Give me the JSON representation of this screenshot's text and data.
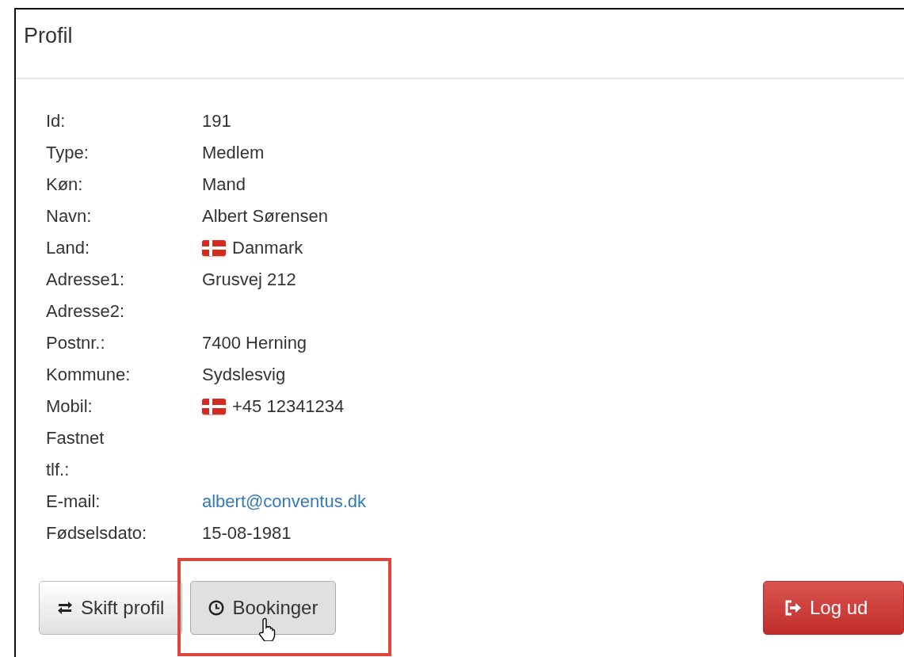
{
  "panel": {
    "title": "Profil"
  },
  "fields": [
    {
      "label": "Id:",
      "value": "191",
      "kind": "text"
    },
    {
      "label": "Type:",
      "value": "Medlem",
      "kind": "text"
    },
    {
      "label": "Køn:",
      "value": "Mand",
      "kind": "text"
    },
    {
      "label": "Navn:",
      "value": "Albert Sørensen",
      "kind": "text"
    },
    {
      "label": "Land:",
      "value": "Danmark",
      "kind": "flag"
    },
    {
      "label": "Adresse1:",
      "value": "Grusvej 212",
      "kind": "text"
    },
    {
      "label": "Adresse2:",
      "kind": "text"
    },
    {
      "label": "Postnr.:",
      "value": "7400 Herning",
      "kind": "text"
    },
    {
      "label": "Kommune:",
      "value": "Sydslesvig",
      "kind": "text"
    },
    {
      "label": "Mobil:",
      "value": "+45 12341234",
      "kind": "flag"
    },
    {
      "label": "Fastnet tlf.:",
      "kind": "text"
    },
    {
      "label": "E-mail:",
      "value": "albert@conventus.dk",
      "kind": "link"
    },
    {
      "label": "Fødselsdato:",
      "value": "15-08-1981",
      "kind": "text"
    }
  ],
  "buttons": [
    {
      "label": "Skift profil",
      "kind": "default",
      "pressed": false,
      "highlighted": false,
      "cursor": false
    },
    {
      "label": "Bookinger",
      "kind": "default",
      "pressed": true,
      "highlighted": true,
      "cursor": true
    },
    {
      "label": "Log ud",
      "kind": "danger",
      "pressed": false,
      "highlighted": false,
      "cursor": false
    }
  ]
}
